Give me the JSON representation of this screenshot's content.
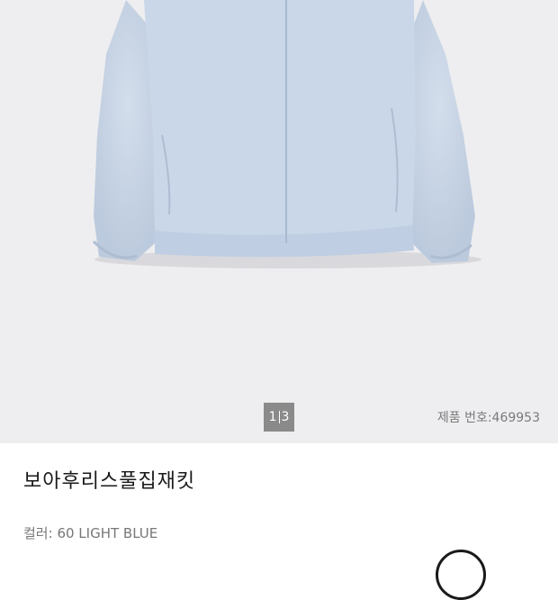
{
  "gallery": {
    "image_alt": "light blue fleece full-zip jacket",
    "current_page": "1",
    "total_pages": "3"
  },
  "product": {
    "number_label": "제품 번호:",
    "number": "469953",
    "name": "보아후리스풀집재킷",
    "color_label": "컬러:",
    "color_value": "60 LIGHT BLUE"
  },
  "colors": {
    "jacket": "#c9d7e8",
    "background": "#eeeef0",
    "pager_bg": "#8a8a8a"
  }
}
